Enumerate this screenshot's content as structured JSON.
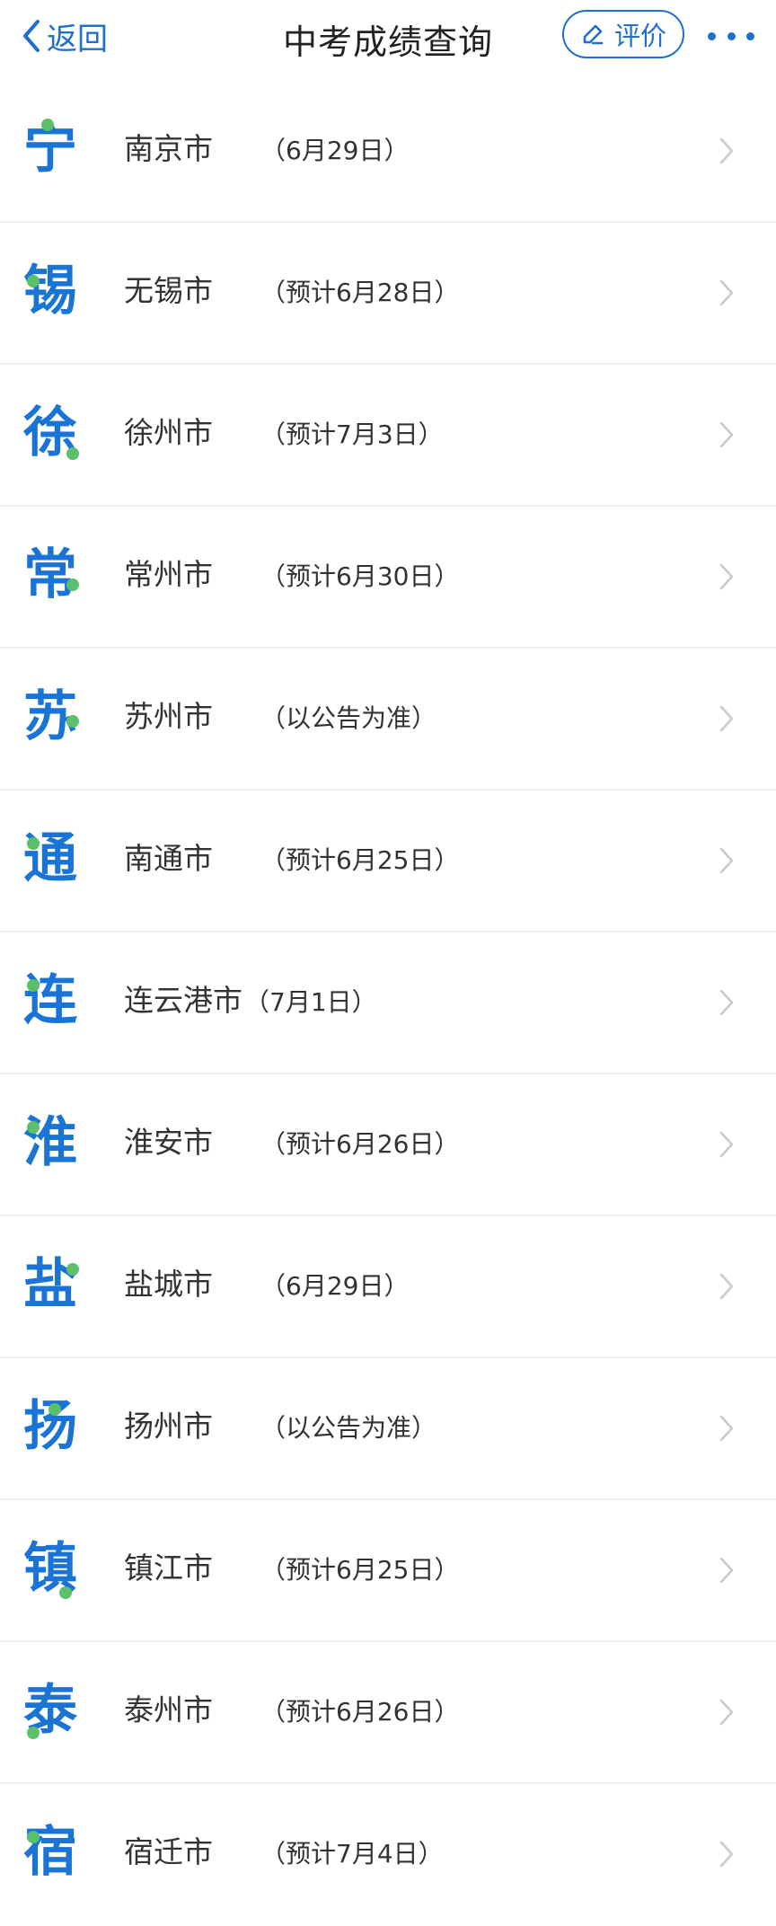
{
  "nav": {
    "back_label": "返回",
    "title": "中考成绩查询",
    "rate_label": "评价",
    "more_icon": "more-dots-icon"
  },
  "colors": {
    "accent": "#1f6fd0",
    "badge_blue": "#1a74d6",
    "badge_dot": "#5bbf6b",
    "text": "#333333",
    "divider": "#ececec"
  },
  "cities": [
    {
      "badge": "宁",
      "name": "南京市",
      "date": "（6月29日）"
    },
    {
      "badge": "锡",
      "name": "无锡市",
      "date": "（预计6月28日）"
    },
    {
      "badge": "徐",
      "name": "徐州市",
      "date": "（预计7月3日）"
    },
    {
      "badge": "常",
      "name": "常州市",
      "date": "（预计6月30日）"
    },
    {
      "badge": "苏",
      "name": "苏州市",
      "date": "（以公告为准）"
    },
    {
      "badge": "通",
      "name": "南通市",
      "date": "（预计6月25日）"
    },
    {
      "badge": "连",
      "name": "连云港市",
      "date": "（7月1日）"
    },
    {
      "badge": "淮",
      "name": "淮安市",
      "date": "（预计6月26日）"
    },
    {
      "badge": "盐",
      "name": "盐城市",
      "date": "（6月29日）"
    },
    {
      "badge": "扬",
      "name": "扬州市",
      "date": "（以公告为准）"
    },
    {
      "badge": "镇",
      "name": "镇江市",
      "date": "（预计6月25日）"
    },
    {
      "badge": "泰",
      "name": "泰州市",
      "date": "（预计6月26日）"
    },
    {
      "badge": "宿",
      "name": "宿迁市",
      "date": "（预计7月4日）"
    }
  ]
}
